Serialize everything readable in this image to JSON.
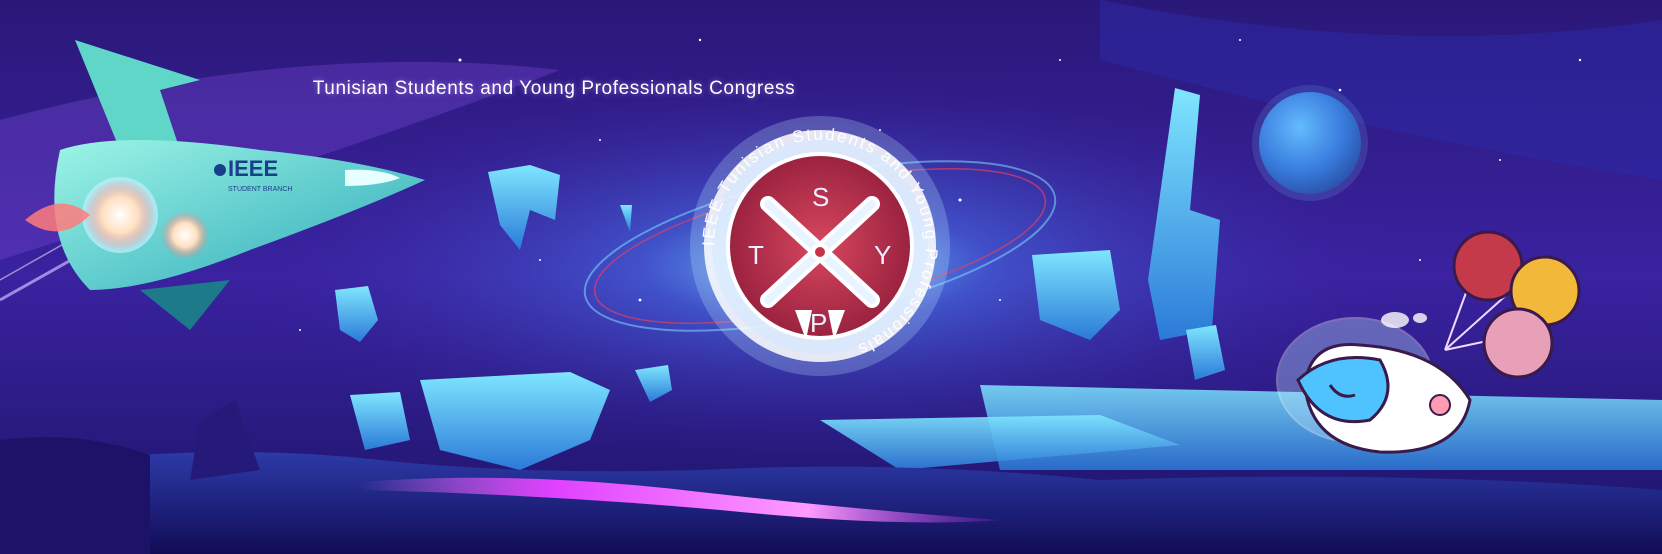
{
  "banner": {
    "title": "Tunisian Students and Young Professionals Congress",
    "ship_label": "IEEE",
    "ship_sublabel": "STUDENT BRANCH",
    "logo": {
      "letters": [
        "S",
        "T",
        "X",
        "Y",
        "P"
      ],
      "ring_text": "IEEE Tunisian Students and Young Professionals"
    }
  },
  "colors": {
    "sky_top": "#2a1878",
    "sky_mid": "#4a2ab0",
    "glow": "#6fe2ff",
    "ice": "#5fd3f5",
    "logo_red": "#c8334a",
    "lava": "#e040ff"
  }
}
